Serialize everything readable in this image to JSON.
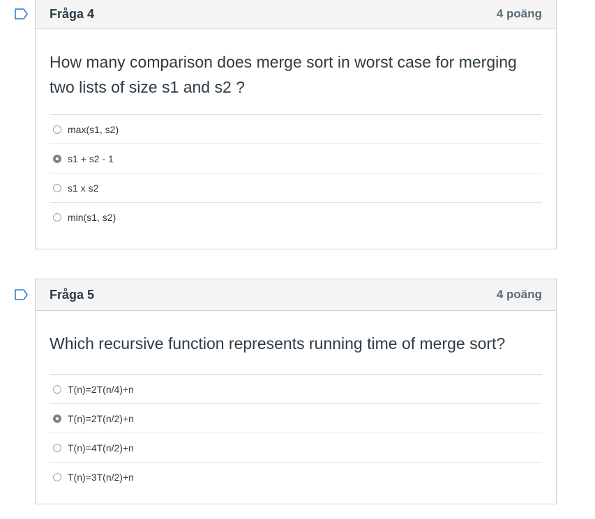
{
  "questions": [
    {
      "title": "Fråga 4",
      "points": "4 poäng",
      "text": "How many comparison does merge sort in worst case for merging two lists of size s1 and s2 ?",
      "answers": [
        {
          "label": "max(s1, s2)",
          "selected": false
        },
        {
          "label": "s1 + s2 - 1",
          "selected": true
        },
        {
          "label": "s1 x s2",
          "selected": false
        },
        {
          "label": "min(s1, s2)",
          "selected": false
        }
      ]
    },
    {
      "title": "Fråga 5",
      "points": "4 poäng",
      "text": "Which recursive function represents running time of merge sort?",
      "answers": [
        {
          "label": "T(n)=2T(n/4)+n",
          "selected": false
        },
        {
          "label": "T(n)=2T(n/2)+n",
          "selected": true
        },
        {
          "label": "T(n)=4T(n/2)+n",
          "selected": false
        },
        {
          "label": "T(n)=3T(n/2)+n",
          "selected": false
        }
      ]
    }
  ],
  "icons": {
    "flag": "bookmark-flag-icon",
    "flag_color": "#2d7dd2"
  }
}
